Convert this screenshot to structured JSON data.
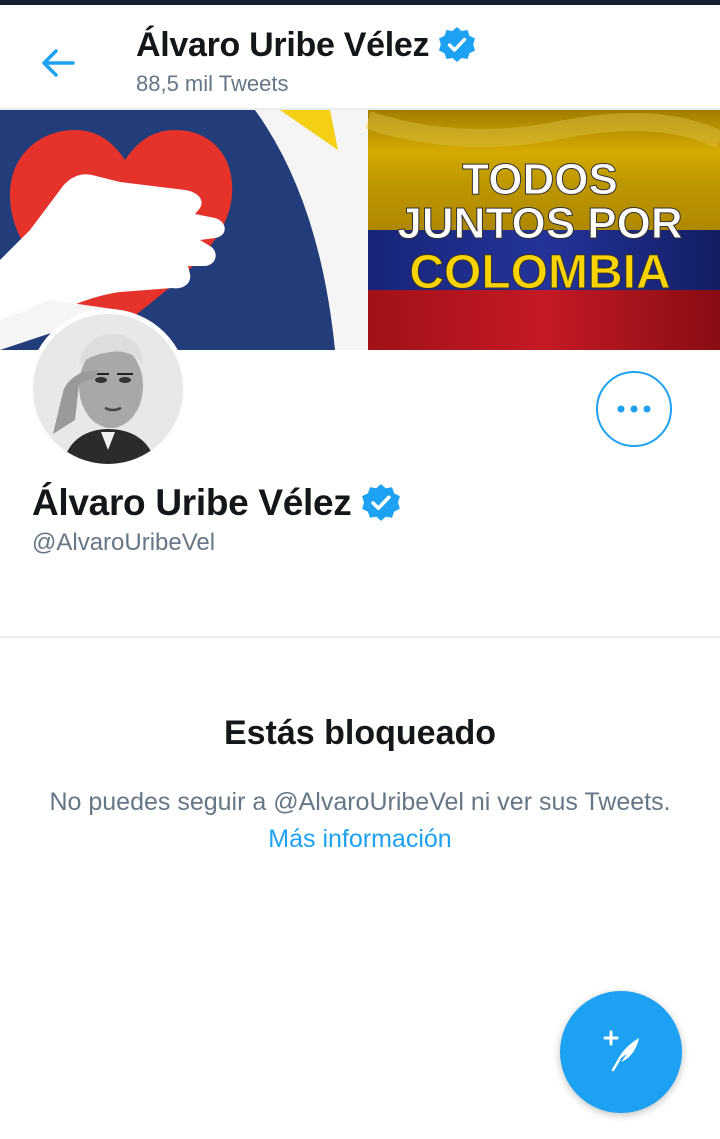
{
  "header": {
    "title": "Álvaro Uribe Vélez",
    "tweet_count": "88,5 mil Tweets"
  },
  "banner": {
    "line1": "TODOS",
    "line2": "JUNTOS POR",
    "line3": "COLOMBIA"
  },
  "profile": {
    "name": "Álvaro Uribe Vélez",
    "handle": "@AlvaroUribeVel"
  },
  "blocked": {
    "title": "Estás bloqueado",
    "message": "No puedes seguir a @AlvaroUribeVel ni ver sus Tweets.",
    "link": "Más información"
  },
  "colors": {
    "accent": "#1da1f2",
    "text": "#14171a",
    "secondary": "#657786",
    "divider": "#e6ecf0"
  },
  "icons": [
    "back-arrow-icon",
    "verified-badge-icon",
    "more-options-icon",
    "compose-tweet-icon"
  ]
}
